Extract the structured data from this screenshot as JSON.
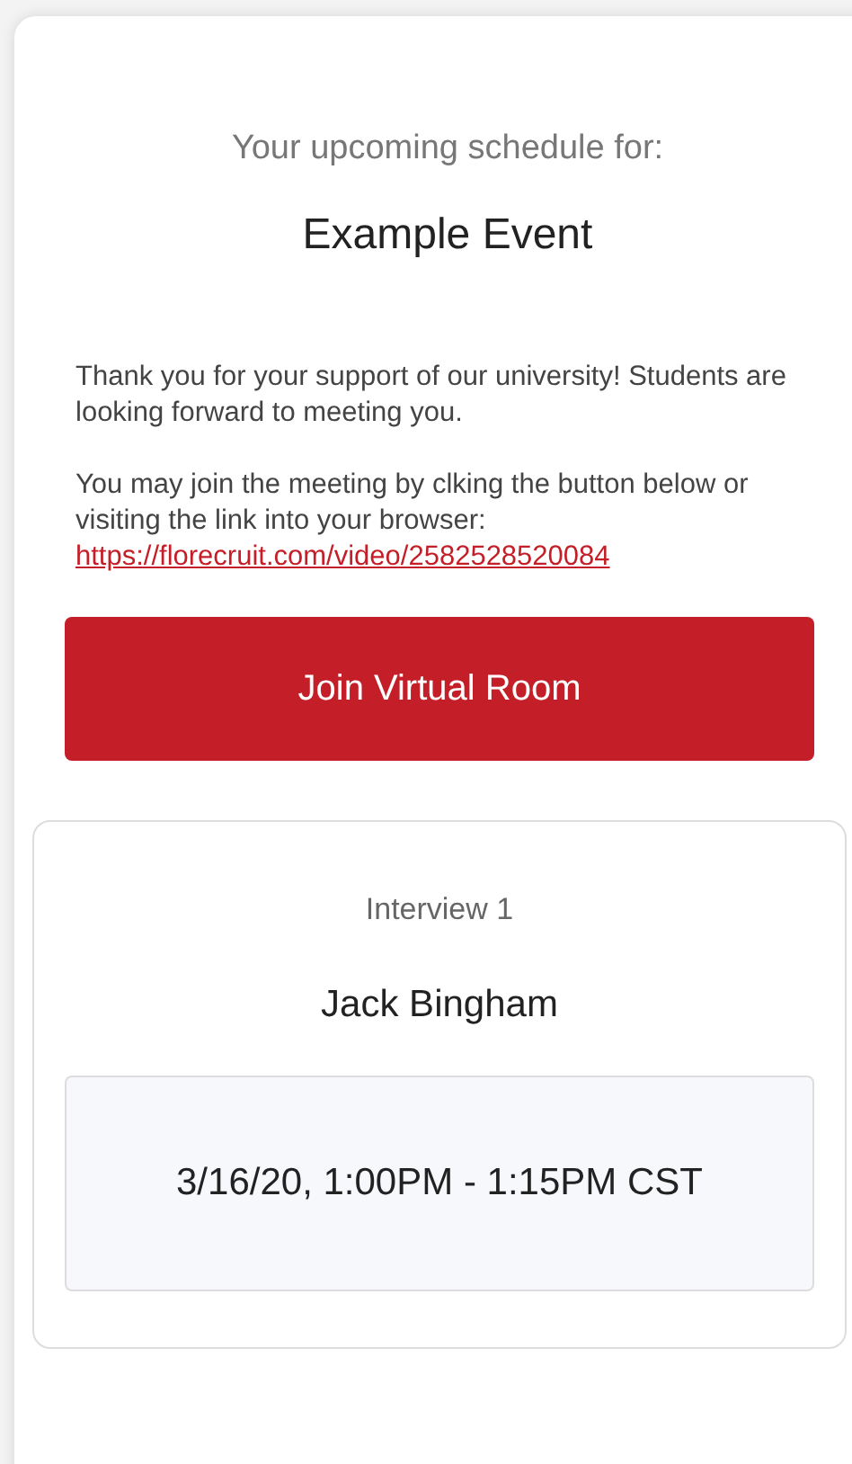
{
  "header": {
    "subtitle": "Your upcoming schedule for:",
    "title": "Example Event"
  },
  "message": {
    "paragraphs": [
      "Thank you for your support of our university! Students are looking forward to meeting you.",
      "You may join the meeting by clking the button below or visiting the link into your browser:"
    ],
    "link": "https://florecruit.com/video/2582528520084"
  },
  "button": {
    "label": "Join Virtual Room"
  },
  "interviews": [
    {
      "label": "Interview 1",
      "name": "Jack Bingham",
      "time": "3/16/20, 1:00PM - 1:15PM CST"
    }
  ]
}
